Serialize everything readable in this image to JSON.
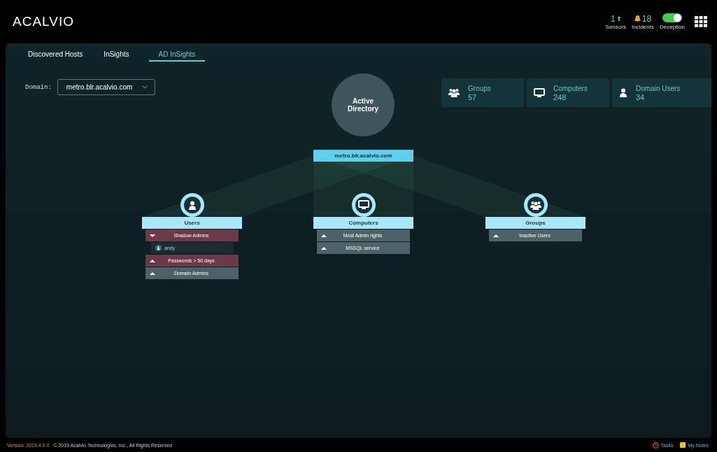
{
  "header": {
    "logo": "ACALVIO",
    "sensors": {
      "value": "1",
      "label": "Sensors"
    },
    "incidents": {
      "value": "18",
      "label": "Incidents"
    },
    "deception": {
      "label": "Deception",
      "on": true
    }
  },
  "tabs": [
    {
      "label": "Discovered Hosts",
      "selected": false
    },
    {
      "label": "InSights",
      "selected": false
    },
    {
      "label": "AD InSights",
      "selected": true
    }
  ],
  "domain": {
    "label": "Domain:",
    "value": "metro.blr.acalvio.com"
  },
  "stats": [
    {
      "kind": "groups",
      "label": "Groups",
      "value": "57"
    },
    {
      "kind": "computers",
      "label": "Computers",
      "value": "248"
    },
    {
      "kind": "users",
      "label": "Domain Users",
      "value": "34"
    }
  ],
  "diagram": {
    "root": "Active Directory",
    "domain": "metro.blr.acalvio.com",
    "categories": [
      {
        "kind": "users",
        "label": "Users",
        "items": [
          {
            "label": "Shadow Admins",
            "alert": true,
            "expanded": true,
            "children": [
              {
                "label": "andy"
              }
            ]
          },
          {
            "label": "Passwords > 50 days",
            "alert": true,
            "expanded": false
          },
          {
            "label": "Domain Admins",
            "alert": false,
            "expanded": false
          }
        ]
      },
      {
        "kind": "computers",
        "label": "Computers",
        "items": [
          {
            "label": "Most Admin rights",
            "alert": false,
            "expanded": false
          },
          {
            "label": "MSSQL service",
            "alert": false,
            "expanded": false
          }
        ]
      },
      {
        "kind": "groups",
        "label": "Groups",
        "items": [
          {
            "label": "Inactive Users",
            "alert": false,
            "expanded": false
          }
        ]
      }
    ]
  },
  "footer": {
    "version": "Version: 2019.4.0.0",
    "copyright": "© 2019 Acalvio Technologies, Inc., All Rights Reserved",
    "tasks": "Tasks",
    "notes": "My Notes"
  }
}
